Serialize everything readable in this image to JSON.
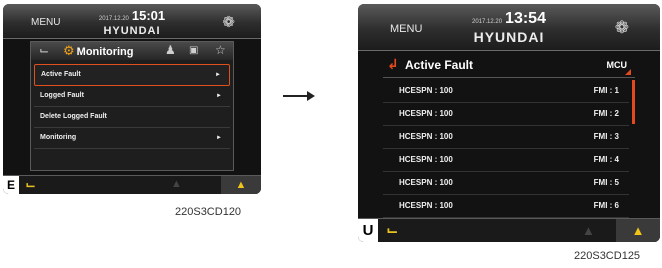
{
  "screen1": {
    "header": {
      "menu_label": "MENU",
      "date": "2017.12.20",
      "time": "15:01",
      "brand": "HYUNDAI",
      "corner_icon": "steering-wheel-icon"
    },
    "tabs": {
      "active_label": "Monitoring",
      "icons": [
        "operator-icon",
        "monitoring-gear-icon",
        "user-icon",
        "camera-icon",
        "star-icon"
      ]
    },
    "menu_items": [
      {
        "label": "Active Fault",
        "arrow": "►",
        "selected": true
      },
      {
        "label": "Logged Fault",
        "arrow": "►",
        "selected": false
      },
      {
        "label": "Delete Logged Fault",
        "arrow": "",
        "selected": false
      },
      {
        "label": "Monitoring",
        "arrow": "►",
        "selected": false
      }
    ],
    "footer": {
      "letter": "E",
      "icon": "operator-icon",
      "machine_icon": "machine-icon"
    },
    "caption": "220S3CD120"
  },
  "screen2": {
    "header": {
      "menu_label": "MENU",
      "date": "2017.12.20",
      "time": "13:54",
      "brand": "HYUNDAI",
      "corner_icon": "steering-wheel-icon"
    },
    "title": "Active Fault",
    "selector": "MCU",
    "faults": [
      {
        "code": "HCESPN : 100",
        "fmi": "FMI : 1"
      },
      {
        "code": "HCESPN : 100",
        "fmi": "FMI : 2"
      },
      {
        "code": "HCESPN : 100",
        "fmi": "FMI : 3"
      },
      {
        "code": "HCESPN : 100",
        "fmi": "FMI : 4"
      },
      {
        "code": "HCESPN : 100",
        "fmi": "FMI : 5"
      },
      {
        "code": "HCESPN : 100",
        "fmi": "FMI : 6"
      }
    ],
    "footer": {
      "letter": "U",
      "icon": "operator-icon",
      "machine_icon": "machine-icon"
    },
    "caption": "220S3CD125"
  },
  "colors": {
    "accent": "#e24a1e",
    "footer_icon": "#e8c21f",
    "screen_bg": "#121212"
  }
}
